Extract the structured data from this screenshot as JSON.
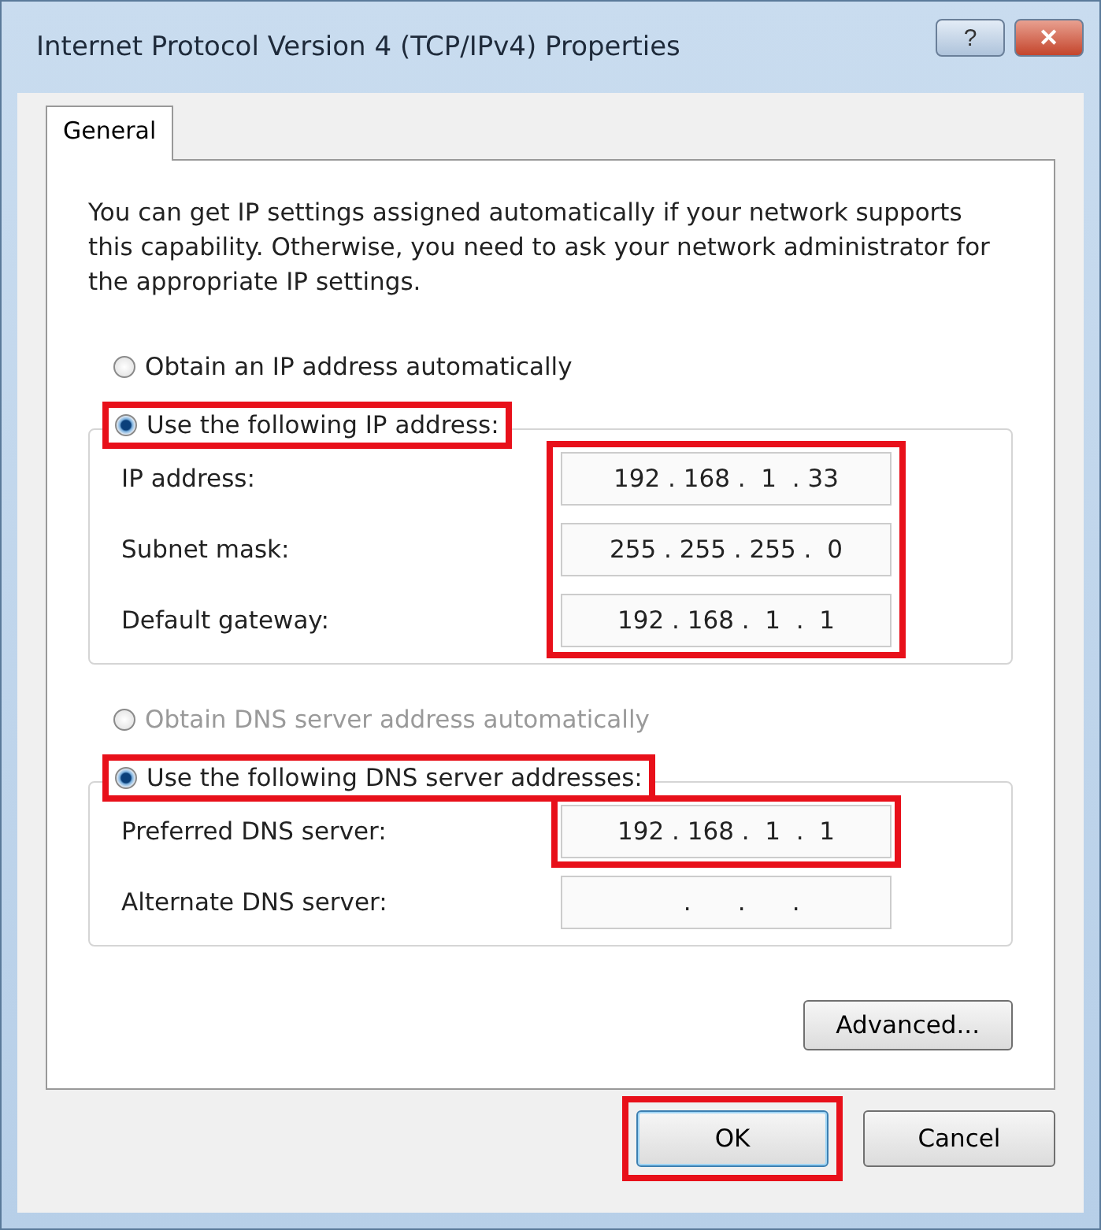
{
  "window": {
    "title": "Internet Protocol Version 4 (TCP/IPv4) Properties",
    "help_label": "?",
    "close_label": "✕"
  },
  "tabs": [
    {
      "label": "General",
      "selected": true
    }
  ],
  "intro": "You can get IP settings assigned automatically if your network supports this capability. Otherwise, you need to ask your network administrator for the appropriate IP settings.",
  "ip_options": [
    {
      "label": "Obtain an IP address automatically",
      "selected": false,
      "disabled": false,
      "highlighted": false
    },
    {
      "label": "Use the following IP address:",
      "selected": true,
      "disabled": false,
      "highlighted": true
    }
  ],
  "ip_group": {
    "highlighted": true,
    "fields": [
      {
        "label": "IP address:",
        "value": "192 . 168 .  1  . 33"
      },
      {
        "label": "Subnet mask:",
        "value": "255 . 255 . 255 .  0"
      },
      {
        "label": "Default gateway:",
        "value": "192 . 168 .  1  .  1"
      }
    ]
  },
  "dns_options": [
    {
      "label": "Obtain DNS server address automatically",
      "selected": false,
      "disabled": true,
      "highlighted": false
    },
    {
      "label": "Use the following DNS server addresses:",
      "selected": true,
      "disabled": false,
      "highlighted": true
    }
  ],
  "dns_group": {
    "fields": [
      {
        "label": "Preferred DNS server:",
        "value": "192 . 168 .  1  .  1",
        "highlighted": true
      },
      {
        "label": "Alternate DNS server:",
        "value": "    .      .      .",
        "highlighted": false
      }
    ]
  },
  "advanced_button": "Advanced...",
  "buttons": [
    {
      "label": "OK",
      "default": true,
      "highlighted": true
    },
    {
      "label": "Cancel",
      "default": false,
      "highlighted": false
    }
  ]
}
